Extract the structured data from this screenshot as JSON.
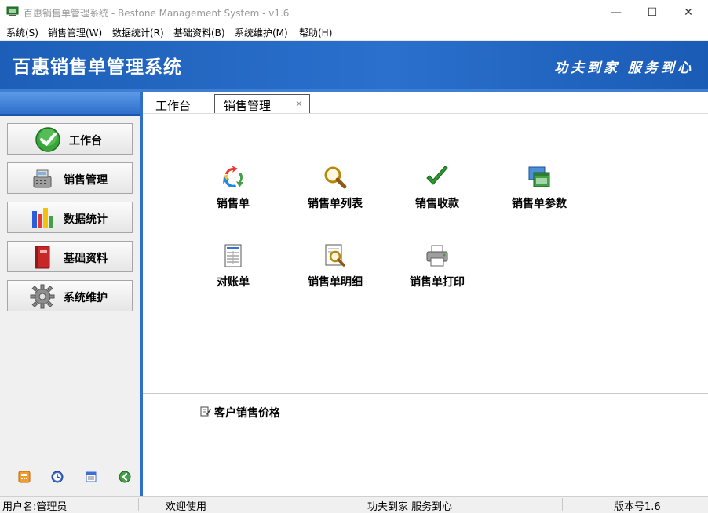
{
  "window": {
    "title": "百惠销售单管理系统 - Bestone Management System - v1.6",
    "minimize": "—",
    "maximize": "☐",
    "close": "✕"
  },
  "menu": [
    {
      "label": "系统(S)"
    },
    {
      "label": "销售管理(W)"
    },
    {
      "label": "数据统计(R)"
    },
    {
      "label": "基础资料(B)"
    },
    {
      "label": "系统维护(M)"
    },
    {
      "label": "帮助(H)"
    }
  ],
  "banner": {
    "title": "百惠销售单管理系统",
    "slogan": "功夫到家 服务到心"
  },
  "sidebar": {
    "items": [
      {
        "label": "工作台",
        "icon": "check-circle-icon"
      },
      {
        "label": "销售管理",
        "icon": "cash-register-icon"
      },
      {
        "label": "数据统计",
        "icon": "bar-chart-icon"
      },
      {
        "label": "基础资料",
        "icon": "book-icon"
      },
      {
        "label": "系统维护",
        "icon": "gear-icon"
      }
    ],
    "tools": [
      "calculator-icon",
      "clock-icon",
      "notepad-icon",
      "back-icon"
    ]
  },
  "tabs": {
    "workbench": "工作台",
    "sales": "销售管理",
    "close": "×"
  },
  "functions": [
    {
      "label": "销售单",
      "icon": "recycle-arrows-icon"
    },
    {
      "label": "销售单列表",
      "icon": "magnifier-icon"
    },
    {
      "label": "销售收款",
      "icon": "checkmark-icon"
    },
    {
      "label": "销售单参数",
      "icon": "windows-stack-icon"
    },
    {
      "label": "对账单",
      "icon": "statement-sheet-icon"
    },
    {
      "label": "销售单明细",
      "icon": "document-magnifier-icon"
    },
    {
      "label": "销售单打印",
      "icon": "printer-icon"
    }
  ],
  "lower_pane": {
    "customer_price": "客户销售价格"
  },
  "status": {
    "user": "用户名:管理员",
    "welcome": "欢迎使用",
    "slogan": "功夫到家 服务到心",
    "version": "版本号1.6"
  }
}
